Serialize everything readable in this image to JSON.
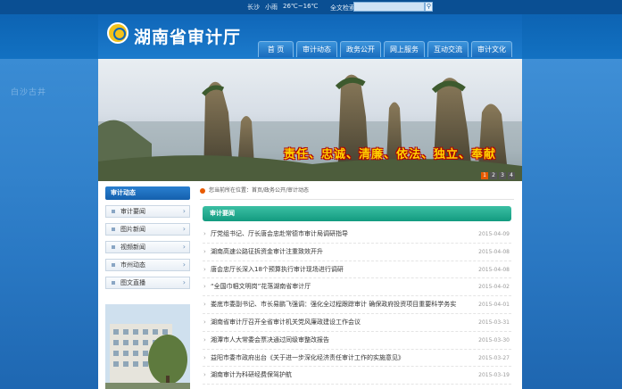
{
  "topbar": {
    "city": "长沙",
    "weather": "小雨",
    "temperature": "26℃~16℃",
    "search_label": "全文检索",
    "search_placeholder": ""
  },
  "header": {
    "site_title": "湖南省审计厅"
  },
  "nav": {
    "items": [
      {
        "label": "首  页"
      },
      {
        "label": "审计动态"
      },
      {
        "label": "政务公开"
      },
      {
        "label": "网上服务"
      },
      {
        "label": "互动交流"
      },
      {
        "label": "审计文化"
      }
    ]
  },
  "banner": {
    "motto": "责任、忠诚、清廉、依法、独立、奉献",
    "slides": [
      "1",
      "2",
      "3",
      "4"
    ],
    "active_slide": "1"
  },
  "left_panel": {
    "heading": "审计动态",
    "items": [
      {
        "label": "审计要闻"
      },
      {
        "label": "图片新闻"
      },
      {
        "label": "视频新闻"
      },
      {
        "label": "市州动态"
      },
      {
        "label": "图文直播"
      }
    ]
  },
  "breadcrumb": {
    "text": "您当前所在位置：首页/政务公开/审计动态"
  },
  "news": {
    "heading": "审计要闻",
    "items": [
      {
        "title": "厅党组书记、厅长唐会忠赴常德市审计局调研指导",
        "date": "2015-04-09"
      },
      {
        "title": "湖南高速公路征拆资金审计注重致效开升",
        "date": "2015-04-08"
      },
      {
        "title": "唐会忠厅长深入18个预算执行审计现场进行调研",
        "date": "2015-04-08"
      },
      {
        "title": "“全国巾帼文明岗”花落湖南省审计厅",
        "date": "2015-04-02"
      },
      {
        "title": "娄底市委副书记、市长易鹏飞强调：强化全过程跟踪审计 确保政府投资项目重要科学务实",
        "date": "2015-04-01"
      },
      {
        "title": "湖南省审计厅召开全省审计机关党风廉政建设工作会议",
        "date": "2015-03-31"
      },
      {
        "title": "湘潭市人大常委会票决通过同级审整改报告",
        "date": "2015-03-30"
      },
      {
        "title": "益阳市委市政府出台《关于进一步深化经济责任审计工作的实施意见》",
        "date": "2015-03-27"
      },
      {
        "title": "湖南审计为科研经费保驾护航",
        "date": "2015-03-19"
      }
    ]
  }
}
